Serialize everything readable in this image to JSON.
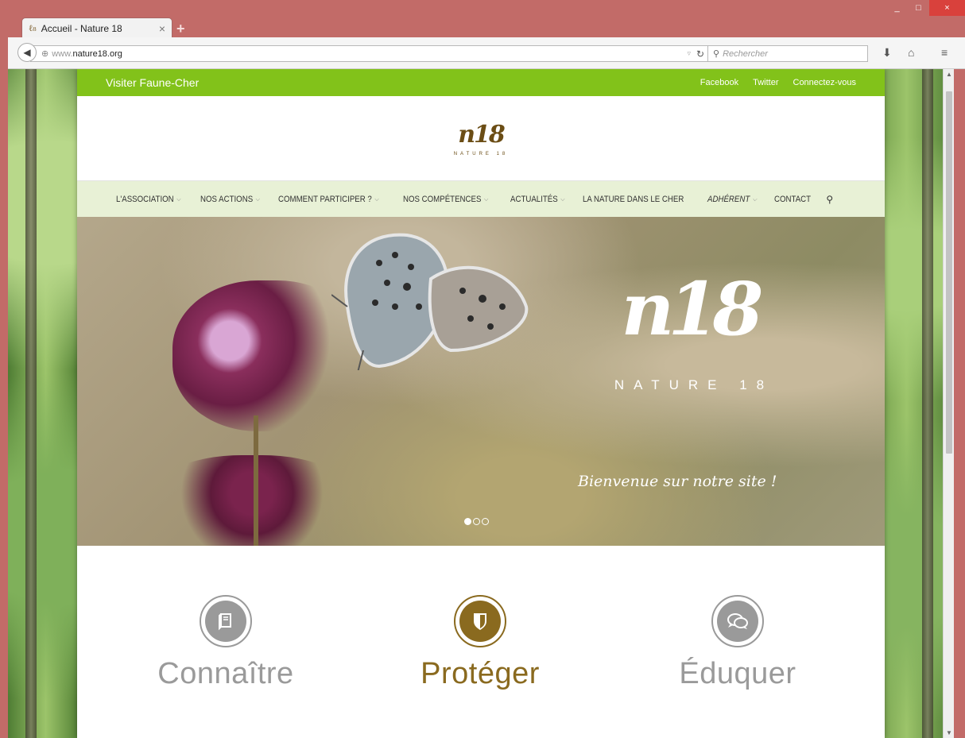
{
  "browser": {
    "tab_title": "Accueil - Nature 18",
    "tab_close": "×",
    "new_tab": "+",
    "url_prefix": "www.",
    "url_host": "nature18.org",
    "search_placeholder": "Rechercher",
    "win_min": "_",
    "win_max": "□",
    "win_close": "×"
  },
  "site": {
    "topbar": {
      "visit_label": "Visiter Faune-Cher",
      "links": [
        "Facebook",
        "Twitter",
        "Connectez-vous"
      ]
    },
    "logo": {
      "mark": "n18",
      "sub": "NATURE 18"
    },
    "menu": [
      {
        "label": "L'ASSOCIATION",
        "dropdown": true
      },
      {
        "label": "NOS ACTIONS",
        "dropdown": true
      },
      {
        "label": "COMMENT PARTICIPER ?",
        "dropdown": true
      },
      {
        "label": "NOS COMPÉTENCES",
        "dropdown": true
      },
      {
        "label": "ACTUALITÉS",
        "dropdown": true
      },
      {
        "label": "LA NATURE DANS LE CHER",
        "dropdown": false
      },
      {
        "label": "ADHÉRENT",
        "dropdown": true,
        "italic": true
      },
      {
        "label": "CONTACT",
        "dropdown": false
      }
    ],
    "hero": {
      "logo_mark": "n18",
      "logo_name": "NATURE 18",
      "tagline": "Bienvenue sur notre site !",
      "slides_total": 3,
      "active_slide": 1
    },
    "features": [
      {
        "label": "Connaître",
        "icon": "book-icon",
        "color": "#9a9a9a"
      },
      {
        "label": "Protéger",
        "icon": "shield-icon",
        "color": "#8a6a1f"
      },
      {
        "label": "Éduquer",
        "icon": "chat-bubbles-icon",
        "color": "#9a9a9a"
      }
    ]
  },
  "colors": {
    "topbar_green": "#82c21a",
    "menu_bg": "#e8f1d6",
    "brand_gold": "#8a6a1f",
    "browser_frame": "#c26b68"
  }
}
